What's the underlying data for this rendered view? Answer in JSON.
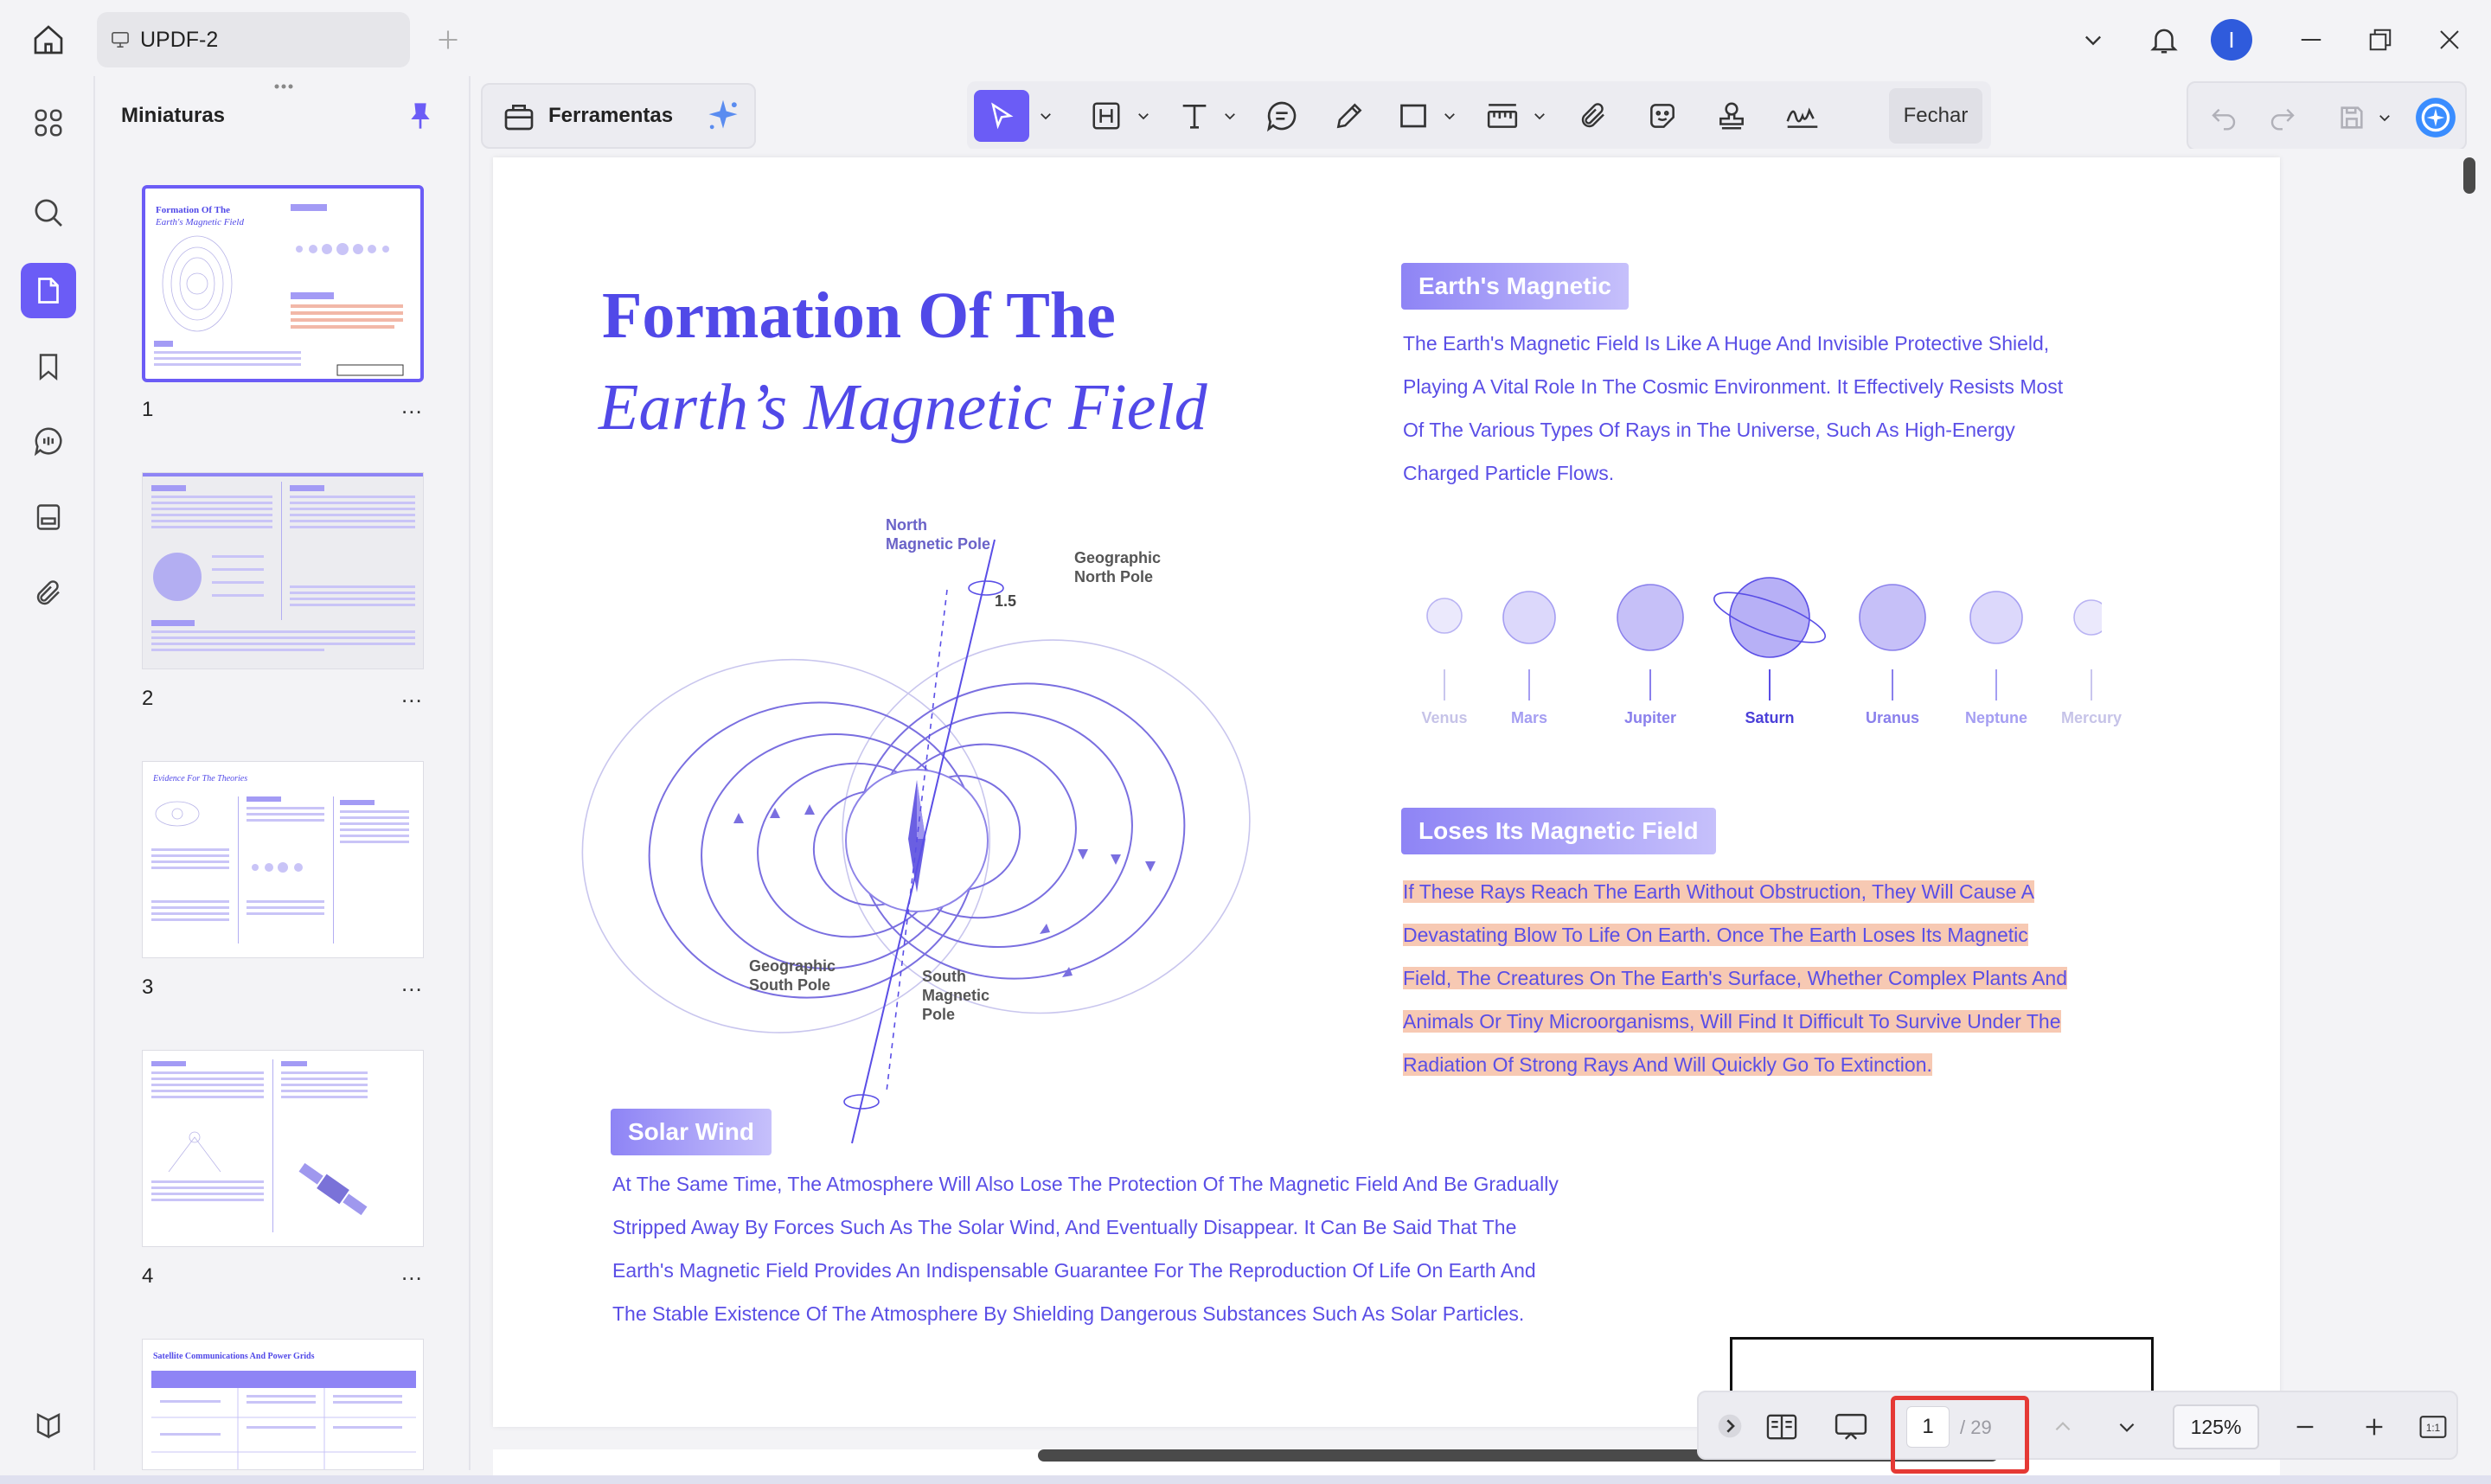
{
  "window": {
    "tab_title": "UPDF-2",
    "avatar_letter": "I"
  },
  "sidebar": {
    "title": "Miniaturas",
    "thumbnails": [
      {
        "page": "1",
        "more": "..."
      },
      {
        "page": "2",
        "more": "..."
      },
      {
        "page": "3",
        "more": "..."
      },
      {
        "page": "4",
        "more": "..."
      }
    ],
    "rail_icons": [
      "thumbnails-grid-icon",
      "search-icon",
      "pages-icon",
      "bookmark-icon",
      "comments-icon",
      "form-icon",
      "attachment-icon",
      "layers-icon"
    ]
  },
  "toolbar": {
    "tools_label": "Ferramentas",
    "close_label": "Fechar"
  },
  "document": {
    "title_line1": "Formation Of The",
    "title_line2": "Earth’s Magnetic Field",
    "diagram": {
      "north_magnetic_pole": [
        "North",
        "Magnetic Pole"
      ],
      "geographic_north_pole": [
        "Geographic",
        "North Pole"
      ],
      "angle": "1.5",
      "geographic_south_pole": [
        "Geographic",
        "South Pole"
      ],
      "south_magnetic_pole": [
        "South",
        "Magnetic",
        "Pole"
      ]
    },
    "section1": {
      "heading": "Earth's Magnetic",
      "lines": [
        "The Earth's Magnetic Field Is Like A Huge And Invisible Protective Shield,",
        "Playing A Vital Role In The Cosmic Environment. It Effectively Resists Most",
        "Of The Various Types Of Rays in The Universe, Such As High-Energy",
        "Charged Particle Flows."
      ]
    },
    "planets": [
      "Venus",
      "Mars",
      "Jupiter",
      "Saturn",
      "Uranus",
      "Neptune",
      "Mercury"
    ],
    "section2": {
      "heading": "Loses Its Magnetic Field",
      "lines": [
        "If These Rays Reach The Earth Without Obstruction, They Will Cause A",
        "Devastating Blow To Life On Earth. Once The Earth Loses Its Magnetic",
        "Field, The Creatures On The Earth's Surface, Whether Complex Plants And",
        "Animals Or Tiny Microorganisms, Will Find It Difficult To Survive Under The",
        "Radiation Of Strong Rays And Will Quickly Go To Extinction."
      ]
    },
    "section3": {
      "heading": "Solar Wind",
      "lines": [
        "At The Same Time, The Atmosphere Will Also Lose The Protection Of The Magnetic Field And Be Gradually",
        "Stripped Away By Forces Such As The Solar Wind, And Eventually Disappear. It Can Be Said That The",
        "Earth's Magnetic Field Provides An Indispensable Guarantee For The Reproduction Of Life On Earth And",
        "The Stable Existence Of The Atmosphere By Shielding Dangerous Substances Such As Solar Particles."
      ]
    }
  },
  "navigation": {
    "current_page": "1",
    "total_pages": "/ 29",
    "zoom": "125%"
  },
  "colors": {
    "accent": "#6b5cf6",
    "doc_text": "#5a4ee6",
    "highlight": "#f7c9b3",
    "page_box_outline": "#e53935"
  }
}
